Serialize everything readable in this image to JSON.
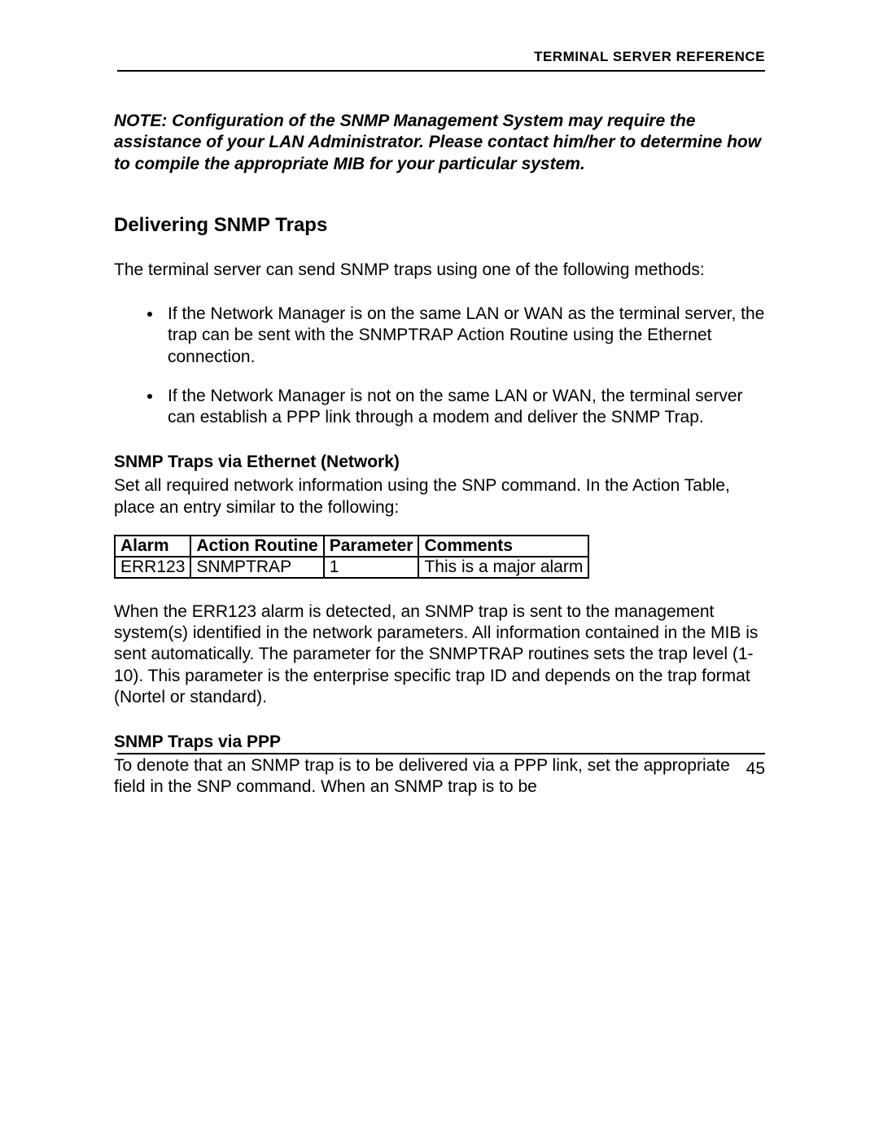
{
  "header": {
    "title": "TERMINAL SERVER REFERENCE"
  },
  "note": "NOTE: Configuration of the SNMP Management System may require the assistance of your LAN Administrator.  Please contact him/her to determine how to compile the appropriate MIB for your particular system.",
  "section": {
    "title": "Delivering SNMP Traps",
    "intro": "The terminal server can send SNMP traps using one of the following methods:",
    "bullets": [
      "If the Network Manager is on the same LAN or WAN as the terminal server, the trap can be sent with the SNMPTRAP Action Routine using the Ethernet connection.",
      "If the Network Manager is not on the same LAN or WAN, the terminal server can establish a PPP link through a modem and deliver the SNMP Trap."
    ]
  },
  "ethernet": {
    "title": "SNMP Traps via Ethernet (Network)",
    "text": "Set all required network information using the SNP command.  In the Action Table, place an entry similar to the following:"
  },
  "table": {
    "headers": [
      "Alarm",
      "Action Routine",
      "Parameter",
      "Comments"
    ],
    "row": [
      "ERR123",
      "SNMPTRAP",
      "1",
      "This is a major alarm"
    ]
  },
  "afterTable": "When the ERR123 alarm is detected, an SNMP trap is sent to the management system(s) identified in the network parameters.  All information contained in the MIB is sent automatically. The parameter for the SNMPTRAP routines sets the trap level (1-10). This parameter is the enterprise specific trap ID and depends on the trap format (Nortel or standard).",
  "ppp": {
    "title": "SNMP Traps via PPP",
    "text": "To denote that an SNMP trap is to be delivered via a PPP link, set the appropriate field in the SNP command.  When an SNMP trap is to be"
  },
  "pageNumber": "45"
}
